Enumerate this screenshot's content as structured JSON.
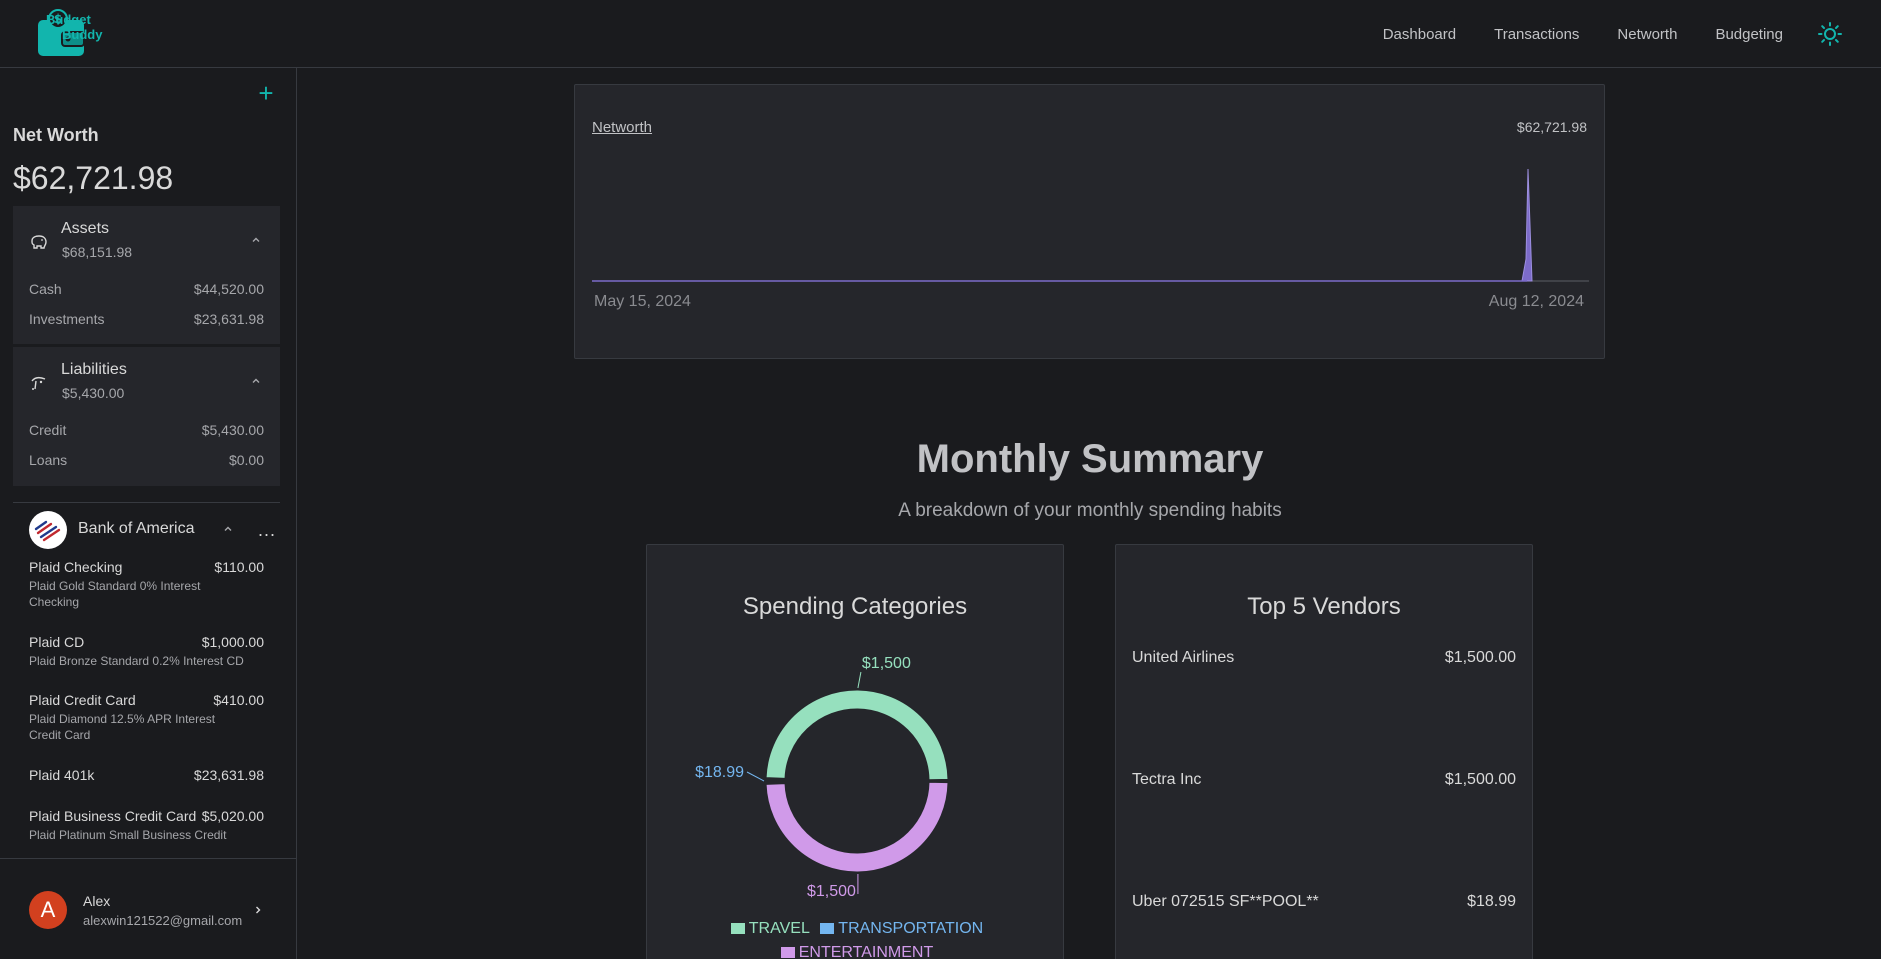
{
  "app": {
    "name_line1": "Budget",
    "name_line2": "Buddy",
    "accent": "#12b5ad"
  },
  "nav": {
    "items": [
      {
        "label": "Dashboard"
      },
      {
        "label": "Transactions"
      },
      {
        "label": "Networth"
      },
      {
        "label": "Budgeting"
      }
    ],
    "theme_icon": "sun-icon"
  },
  "sidebar": {
    "add_icon": "plus-icon",
    "networth_title": "Net Worth",
    "networth_value": "$62,721.98",
    "assets": {
      "title": "Assets",
      "total": "$68,151.98",
      "icon": "piggy-bank-icon",
      "rows": [
        {
          "label": "Cash",
          "value": "$44,520.00"
        },
        {
          "label": "Investments",
          "value": "$23,631.98"
        }
      ]
    },
    "liabilities": {
      "title": "Liabilities",
      "total": "$5,430.00",
      "icon": "hand-coin-icon",
      "rows": [
        {
          "label": "Credit",
          "value": "$5,430.00"
        },
        {
          "label": "Loans",
          "value": "$0.00"
        }
      ]
    },
    "bank": {
      "name": "Bank of America",
      "more": "...",
      "accounts": [
        {
          "name": "Plaid Checking",
          "value": "$110.00",
          "desc": "Plaid Gold Standard 0% Interest Checking"
        },
        {
          "name": "Plaid CD",
          "value": "$1,000.00",
          "desc": "Plaid Bronze Standard 0.2% Interest CD"
        },
        {
          "name": "Plaid Credit Card",
          "value": "$410.00",
          "desc": "Plaid Diamond 12.5% APR Interest Credit Card"
        },
        {
          "name": "Plaid 401k",
          "value": "$23,631.98",
          "desc": ""
        },
        {
          "name": "Plaid Business Credit Card",
          "value": "$5,020.00",
          "desc": "Plaid Platinum Small Business Credit"
        }
      ]
    },
    "user": {
      "initial": "A",
      "name": "Alex",
      "email": "alexwin121522@gmail.com"
    }
  },
  "networth_chart": {
    "link_label": "Networth",
    "value_label": "$62,721.98",
    "tick_start": "May 15, 2024",
    "tick_end": "Aug 12, 2024"
  },
  "monthly_summary": {
    "title": "Monthly Summary",
    "subtitle": "A breakdown of your monthly spending habits",
    "spending": {
      "title": "Spending Categories"
    },
    "vendors": {
      "title": "Top 5 Vendors",
      "items": [
        {
          "name": "United Airlines",
          "amount": "$1,500.00"
        },
        {
          "name": "Tectra Inc",
          "amount": "$1,500.00"
        },
        {
          "name": "Uber 072515 SF**POOL**",
          "amount": "$18.99"
        }
      ]
    }
  },
  "chart_data": [
    {
      "type": "area",
      "x": [
        "May 15, 2024",
        "Aug 12, 2024"
      ],
      "xlabel": "",
      "ylabel": "",
      "color": "#7c6bc9"
    },
    {
      "type": "pie",
      "labels": [
        "TRAVEL",
        "TRANSPORTATION",
        "ENTERTAINMENT"
      ],
      "values": [
        1500,
        18.99,
        1500
      ],
      "value_labels": [
        "$1,500",
        "$18.99",
        "$1,500"
      ],
      "colors": [
        "#96e0be",
        "#74b6f0",
        "#d09ae9"
      ]
    }
  ]
}
